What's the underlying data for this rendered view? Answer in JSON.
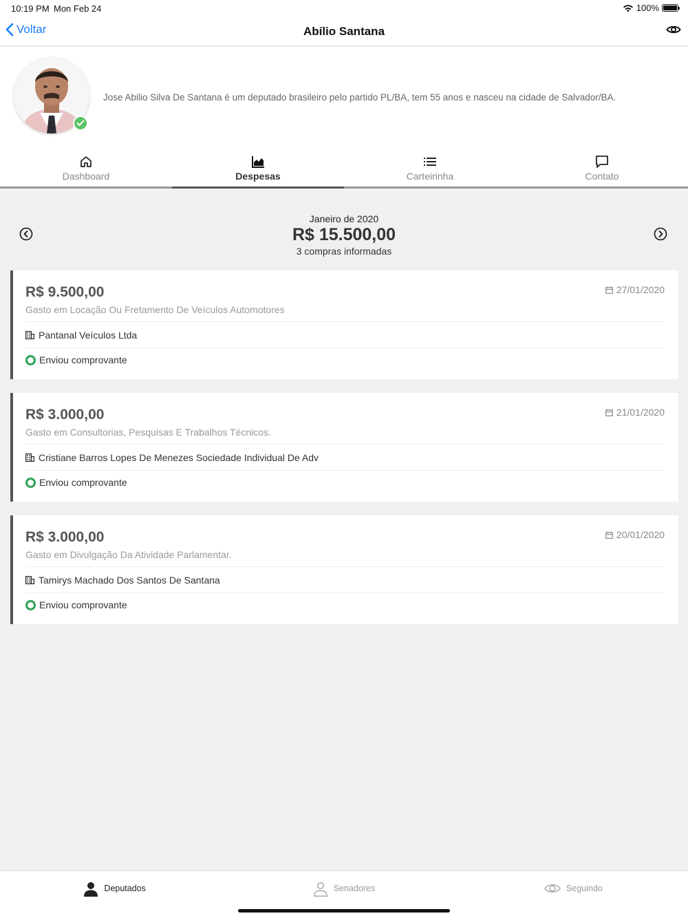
{
  "status": {
    "time": "10:19 PM",
    "date": "Mon Feb 24",
    "battery": "100%"
  },
  "nav": {
    "back_label": "Voltar",
    "title": "Abílio Santana"
  },
  "profile": {
    "bio": "Jose Abilio Silva De Santana é um deputado brasileiro pelo partido PL/BA, tem 55 anos e nasceu na cidade de Salvador/BA."
  },
  "tabs": [
    {
      "label": "Dashboard",
      "icon": "home-icon",
      "active": false
    },
    {
      "label": "Despesas",
      "icon": "chart-icon",
      "active": true
    },
    {
      "label": "Carteirinha",
      "icon": "list-icon",
      "active": false
    },
    {
      "label": "Contato",
      "icon": "message-icon",
      "active": false
    }
  ],
  "summary": {
    "month": "Janeiro de 2020",
    "total": "R$ 15.500,00",
    "count": "3 compras informadas"
  },
  "expenses": [
    {
      "amount": "R$ 9.500,00",
      "date": "27/01/2020",
      "description": "Gasto em Locação Ou Fretamento De Veículos Automotores",
      "vendor": "Pantanal Veículos Ltda",
      "receipt": "Enviou comprovante"
    },
    {
      "amount": "R$ 3.000,00",
      "date": "21/01/2020",
      "description": "Gasto em Consultorias, Pesquisas E Trabalhos Técnicos.",
      "vendor": "Cristiane Barros Lopes De Menezes Sociedade Individual De Adv",
      "receipt": "Enviou comprovante"
    },
    {
      "amount": "R$ 3.000,00",
      "date": "20/01/2020",
      "description": "Gasto em Divulgação Da Atividade Parlamentar.",
      "vendor": "Tamirys Machado Dos Santos De Santana",
      "receipt": "Enviou comprovante"
    }
  ],
  "bottom_tabs": [
    {
      "label": "Deputados",
      "icon": "person-filled-icon",
      "active": true
    },
    {
      "label": "Senadores",
      "icon": "person-outline-icon",
      "active": false
    },
    {
      "label": "Seguindo",
      "icon": "eye-icon",
      "active": false
    }
  ],
  "colors": {
    "accent": "#1a7ef7",
    "success": "#2ea25a",
    "card_border": "#555555",
    "background": "#f0f0f0"
  }
}
